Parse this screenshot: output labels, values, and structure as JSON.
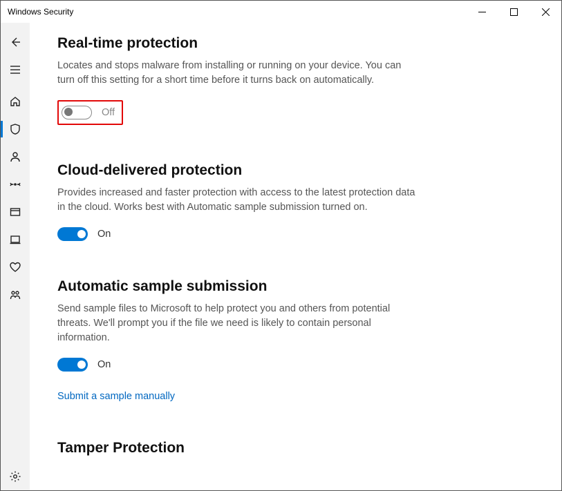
{
  "window": {
    "title": "Windows Security"
  },
  "sections": {
    "realtime": {
      "title": "Real-time protection",
      "desc": "Locates and stops malware from installing or running on your device. You can turn off this setting for a short time before it turns back on automatically.",
      "toggle_label": "Off"
    },
    "cloud": {
      "title": "Cloud-delivered protection",
      "desc": "Provides increased and faster protection with access to the latest protection data in the cloud. Works best with Automatic sample submission turned on.",
      "toggle_label": "On"
    },
    "sample": {
      "title": "Automatic sample submission",
      "desc": "Send sample files to Microsoft to help protect you and others from potential threats. We'll prompt you if the file we need is likely to contain personal information.",
      "toggle_label": "On",
      "link": "Submit a sample manually"
    },
    "tamper": {
      "title": "Tamper Protection"
    }
  }
}
